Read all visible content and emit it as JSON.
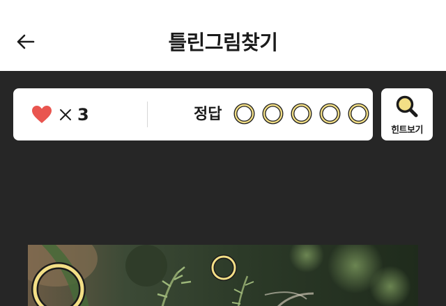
{
  "header": {
    "title": "틀린그림찾기",
    "back_icon": "arrow-left-icon"
  },
  "status": {
    "lives_icon": "heart-icon",
    "lives_count": "3",
    "answer_label": "정답",
    "answer_slots": 5,
    "answers_found": 0
  },
  "hint": {
    "label": "힌트보기",
    "icon": "magnifier-icon"
  },
  "colors": {
    "background": "#262626",
    "accent_yellow": "#f3df86",
    "marker_outline": "#1b1b1b",
    "heart": "#e9554f"
  }
}
